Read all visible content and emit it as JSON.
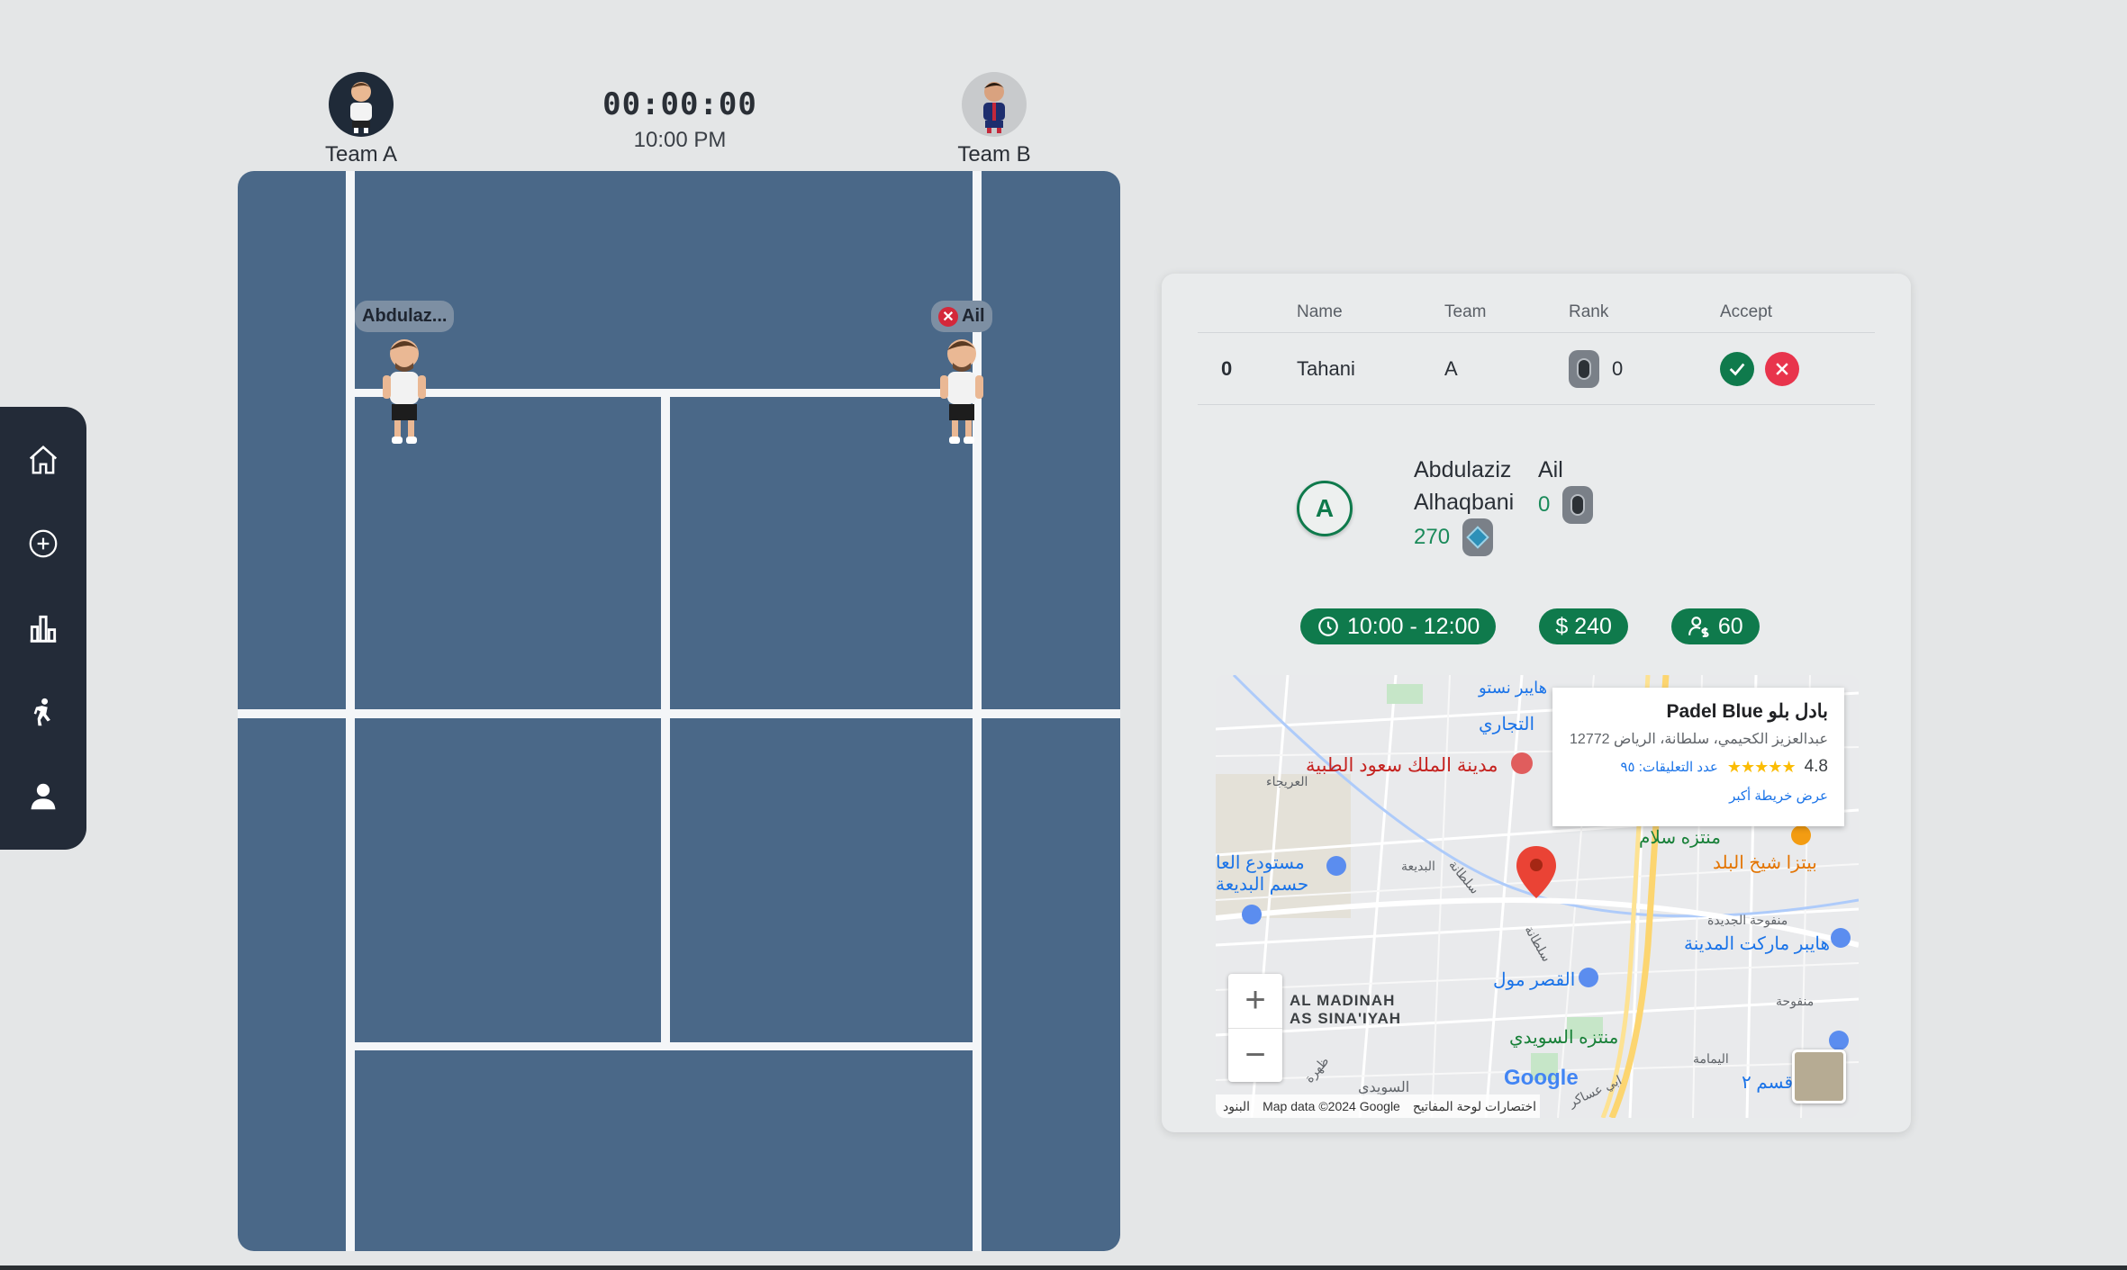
{
  "sidebar": {
    "items": [
      {
        "name": "home",
        "icon": "home-icon"
      },
      {
        "name": "create",
        "icon": "plus-circle-icon"
      },
      {
        "name": "rankings",
        "icon": "bar-chart-icon"
      },
      {
        "name": "play",
        "icon": "player-icon"
      },
      {
        "name": "profile",
        "icon": "user-icon"
      }
    ]
  },
  "header": {
    "team_a": "Team A",
    "team_b": "Team B",
    "clock": "00:00:00",
    "time": "10:00 PM"
  },
  "court": {
    "color": "#4a6888",
    "players": [
      {
        "tag": "Abdulaz...",
        "removable": false
      },
      {
        "tag": "Ail",
        "removable": true
      }
    ]
  },
  "requests": {
    "headers": [
      "Name",
      "Team",
      "Rank",
      "Accept"
    ],
    "rows": [
      {
        "index": "0",
        "name": "Tahani",
        "team": "A",
        "rank": "0"
      }
    ]
  },
  "team_card": {
    "badge": "A",
    "member1_first": "Abdulaziz",
    "member1_last": "Alhaqbani",
    "member1_score": "270",
    "member2_name": "Ail",
    "member2_score": "0"
  },
  "chips": {
    "time": "10:00 - 12:00",
    "price": "$ 240",
    "players": "60"
  },
  "map": {
    "info_title": "بادل بلو Padel Blue",
    "info_address": "عبدالعزيز الكحيمي، سلطانة، الرياض 12772",
    "rating": "4.8",
    "stars": "★★★★★",
    "reviews": "عدد التعليقات: ٩٥",
    "larger_map": "عرض خريطة أكبر",
    "google": "Google",
    "attribution": "Map data ©2024 Google",
    "shortcuts": "اختصارات لوحة المفاتيح",
    "terms": "البنود",
    "labels": {
      "hospital": "مدينة الملك سعود الطبية",
      "tijari": "التجاري",
      "salam_park": "منتزه سلام",
      "pizza": "بيتزا شيخ البلد",
      "warehouse": "مستودع العا",
      "hasm": "حسم البديعة",
      "hyper": "هايبر ماركت المدينة",
      "qasr": "القصر مول",
      "suwaidi_park": "منتزه السويدي",
      "al_madinah": "AL MADINAH",
      "as_sinaiyah": "AS SINA'IYAH",
      "ureija": "العريجاء",
      "badia": "البديعة",
      "sultana": "سلطانة",
      "sultana2": "سلطانة",
      "manfuha_new": "منفوحة الجديدة",
      "manfuha": "منفوحة",
      "yamama": "اليمامة",
      "suwaidi": "السويدي",
      "abu_asaker": "ابي عساكر",
      "qism": "قسم ٢",
      "hyper2": "هايبر نستو",
      "zahir": "ظهرة"
    }
  }
}
